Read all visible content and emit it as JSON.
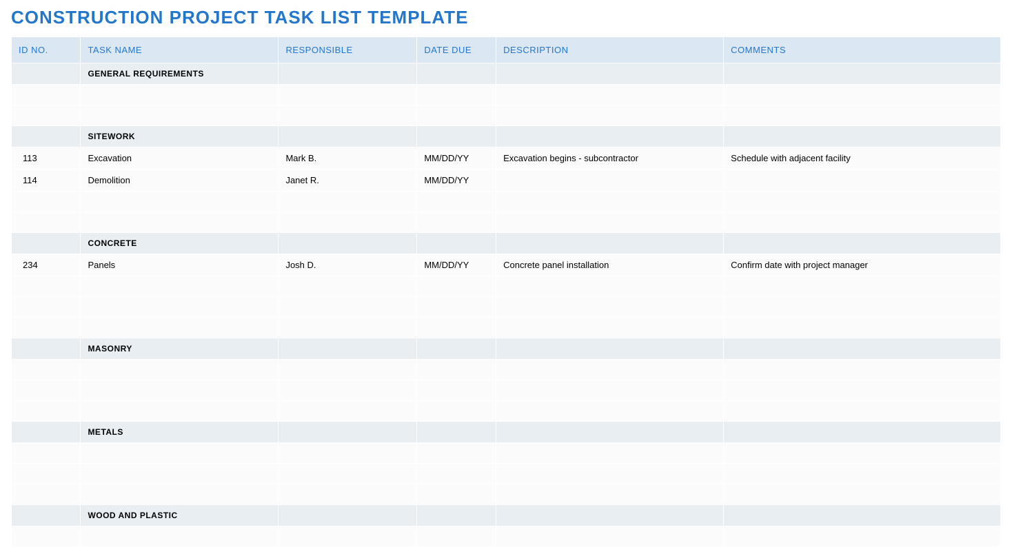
{
  "title": "CONSTRUCTION PROJECT TASK LIST TEMPLATE",
  "columns": {
    "id": "ID NO.",
    "task": "TASK NAME",
    "responsible": "RESPONSIBLE",
    "due": "DATE DUE",
    "description": "DESCRIPTION",
    "comments": "COMMENTS"
  },
  "rows": [
    {
      "type": "section",
      "task": "GENERAL REQUIREMENTS"
    },
    {
      "type": "data"
    },
    {
      "type": "data"
    },
    {
      "type": "section",
      "task": "SITEWORK"
    },
    {
      "type": "data",
      "id": "113",
      "task": "Excavation",
      "responsible": "Mark B.",
      "due": "MM/DD/YY",
      "description": "Excavation begins - subcontractor",
      "comments": "Schedule with adjacent facility"
    },
    {
      "type": "data",
      "id": "114",
      "task": "Demolition",
      "responsible": "Janet R.",
      "due": "MM/DD/YY"
    },
    {
      "type": "data"
    },
    {
      "type": "data"
    },
    {
      "type": "section",
      "task": "CONCRETE"
    },
    {
      "type": "data",
      "id": "234",
      "task": "Panels",
      "responsible": "Josh D.",
      "due": "MM/DD/YY",
      "description": "Concrete panel installation",
      "comments": "Confirm date with project manager"
    },
    {
      "type": "data"
    },
    {
      "type": "data"
    },
    {
      "type": "data"
    },
    {
      "type": "section",
      "task": "MASONRY"
    },
    {
      "type": "data"
    },
    {
      "type": "data"
    },
    {
      "type": "data"
    },
    {
      "type": "section",
      "task": "METALS"
    },
    {
      "type": "data"
    },
    {
      "type": "data"
    },
    {
      "type": "data"
    },
    {
      "type": "section",
      "task": "WOOD AND PLASTIC"
    },
    {
      "type": "data"
    }
  ]
}
